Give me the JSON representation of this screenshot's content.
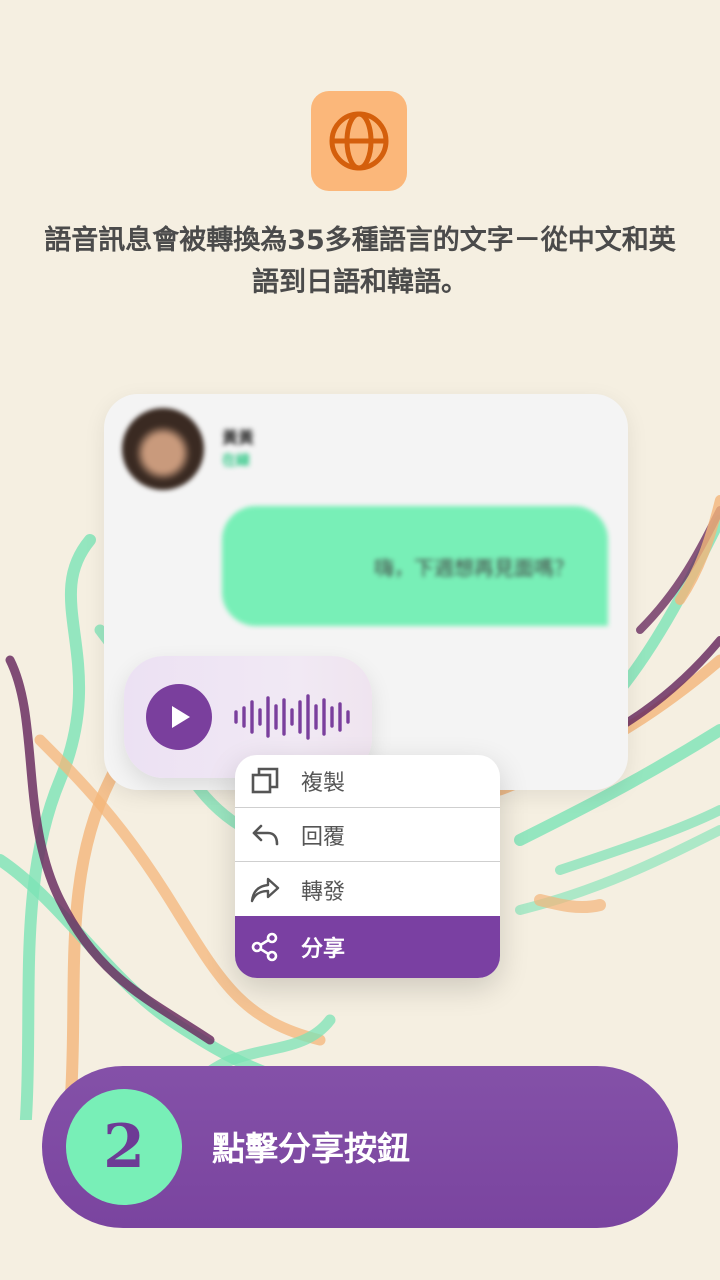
{
  "header": {
    "icon": "globe-icon",
    "text": "語音訊息會被轉換為35多種語言的文字－從中文和英語到日語和韓語。"
  },
  "chat": {
    "contact_name": "黃黃",
    "contact_status": "在線",
    "message": "嗨，下週想再見面嗎？"
  },
  "audio_message": {
    "play_icon": "play-icon",
    "waveform_icon": "waveform-icon"
  },
  "menu": {
    "items": [
      {
        "label": "複製",
        "icon": "copy-icon"
      },
      {
        "label": "回覆",
        "icon": "reply-icon"
      },
      {
        "label": "轉發",
        "icon": "forward-icon"
      },
      {
        "label": "分享",
        "icon": "share-icon"
      }
    ]
  },
  "step": {
    "number": "2",
    "label": "點擊分享按鈕"
  },
  "colors": {
    "background": "#f5efe1",
    "accent_purple": "#7a40a2",
    "accent_green": "#78efb7",
    "accent_orange": "#fbb77a"
  }
}
